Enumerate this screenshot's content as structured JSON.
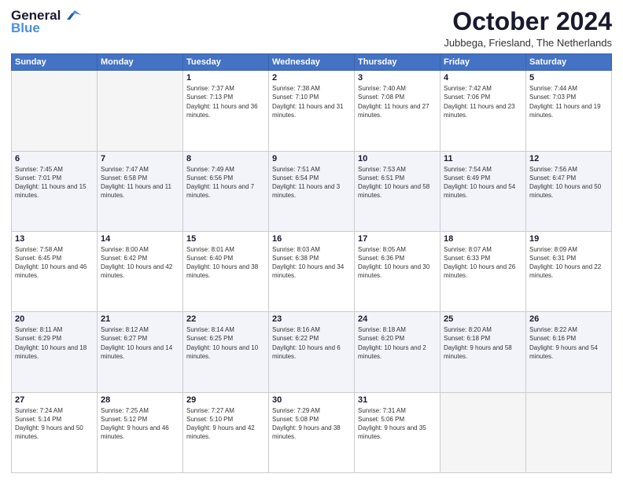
{
  "header": {
    "logo_general": "General",
    "logo_blue": "Blue",
    "month": "October 2024",
    "location": "Jubbega, Friesland, The Netherlands"
  },
  "days_of_week": [
    "Sunday",
    "Monday",
    "Tuesday",
    "Wednesday",
    "Thursday",
    "Friday",
    "Saturday"
  ],
  "weeks": [
    [
      {
        "day": "",
        "info": ""
      },
      {
        "day": "",
        "info": ""
      },
      {
        "day": "1",
        "info": "Sunrise: 7:37 AM\nSunset: 7:13 PM\nDaylight: 11 hours and 36 minutes."
      },
      {
        "day": "2",
        "info": "Sunrise: 7:38 AM\nSunset: 7:10 PM\nDaylight: 11 hours and 31 minutes."
      },
      {
        "day": "3",
        "info": "Sunrise: 7:40 AM\nSunset: 7:08 PM\nDaylight: 11 hours and 27 minutes."
      },
      {
        "day": "4",
        "info": "Sunrise: 7:42 AM\nSunset: 7:06 PM\nDaylight: 11 hours and 23 minutes."
      },
      {
        "day": "5",
        "info": "Sunrise: 7:44 AM\nSunset: 7:03 PM\nDaylight: 11 hours and 19 minutes."
      }
    ],
    [
      {
        "day": "6",
        "info": "Sunrise: 7:45 AM\nSunset: 7:01 PM\nDaylight: 11 hours and 15 minutes."
      },
      {
        "day": "7",
        "info": "Sunrise: 7:47 AM\nSunset: 6:58 PM\nDaylight: 11 hours and 11 minutes."
      },
      {
        "day": "8",
        "info": "Sunrise: 7:49 AM\nSunset: 6:56 PM\nDaylight: 11 hours and 7 minutes."
      },
      {
        "day": "9",
        "info": "Sunrise: 7:51 AM\nSunset: 6:54 PM\nDaylight: 11 hours and 3 minutes."
      },
      {
        "day": "10",
        "info": "Sunrise: 7:53 AM\nSunset: 6:51 PM\nDaylight: 10 hours and 58 minutes."
      },
      {
        "day": "11",
        "info": "Sunrise: 7:54 AM\nSunset: 6:49 PM\nDaylight: 10 hours and 54 minutes."
      },
      {
        "day": "12",
        "info": "Sunrise: 7:56 AM\nSunset: 6:47 PM\nDaylight: 10 hours and 50 minutes."
      }
    ],
    [
      {
        "day": "13",
        "info": "Sunrise: 7:58 AM\nSunset: 6:45 PM\nDaylight: 10 hours and 46 minutes."
      },
      {
        "day": "14",
        "info": "Sunrise: 8:00 AM\nSunset: 6:42 PM\nDaylight: 10 hours and 42 minutes."
      },
      {
        "day": "15",
        "info": "Sunrise: 8:01 AM\nSunset: 6:40 PM\nDaylight: 10 hours and 38 minutes."
      },
      {
        "day": "16",
        "info": "Sunrise: 8:03 AM\nSunset: 6:38 PM\nDaylight: 10 hours and 34 minutes."
      },
      {
        "day": "17",
        "info": "Sunrise: 8:05 AM\nSunset: 6:36 PM\nDaylight: 10 hours and 30 minutes."
      },
      {
        "day": "18",
        "info": "Sunrise: 8:07 AM\nSunset: 6:33 PM\nDaylight: 10 hours and 26 minutes."
      },
      {
        "day": "19",
        "info": "Sunrise: 8:09 AM\nSunset: 6:31 PM\nDaylight: 10 hours and 22 minutes."
      }
    ],
    [
      {
        "day": "20",
        "info": "Sunrise: 8:11 AM\nSunset: 6:29 PM\nDaylight: 10 hours and 18 minutes."
      },
      {
        "day": "21",
        "info": "Sunrise: 8:12 AM\nSunset: 6:27 PM\nDaylight: 10 hours and 14 minutes."
      },
      {
        "day": "22",
        "info": "Sunrise: 8:14 AM\nSunset: 6:25 PM\nDaylight: 10 hours and 10 minutes."
      },
      {
        "day": "23",
        "info": "Sunrise: 8:16 AM\nSunset: 6:22 PM\nDaylight: 10 hours and 6 minutes."
      },
      {
        "day": "24",
        "info": "Sunrise: 8:18 AM\nSunset: 6:20 PM\nDaylight: 10 hours and 2 minutes."
      },
      {
        "day": "25",
        "info": "Sunrise: 8:20 AM\nSunset: 6:18 PM\nDaylight: 9 hours and 58 minutes."
      },
      {
        "day": "26",
        "info": "Sunrise: 8:22 AM\nSunset: 6:16 PM\nDaylight: 9 hours and 54 minutes."
      }
    ],
    [
      {
        "day": "27",
        "info": "Sunrise: 7:24 AM\nSunset: 5:14 PM\nDaylight: 9 hours and 50 minutes."
      },
      {
        "day": "28",
        "info": "Sunrise: 7:25 AM\nSunset: 5:12 PM\nDaylight: 9 hours and 46 minutes."
      },
      {
        "day": "29",
        "info": "Sunrise: 7:27 AM\nSunset: 5:10 PM\nDaylight: 9 hours and 42 minutes."
      },
      {
        "day": "30",
        "info": "Sunrise: 7:29 AM\nSunset: 5:08 PM\nDaylight: 9 hours and 38 minutes."
      },
      {
        "day": "31",
        "info": "Sunrise: 7:31 AM\nSunset: 5:06 PM\nDaylight: 9 hours and 35 minutes."
      },
      {
        "day": "",
        "info": ""
      },
      {
        "day": "",
        "info": ""
      }
    ]
  ]
}
